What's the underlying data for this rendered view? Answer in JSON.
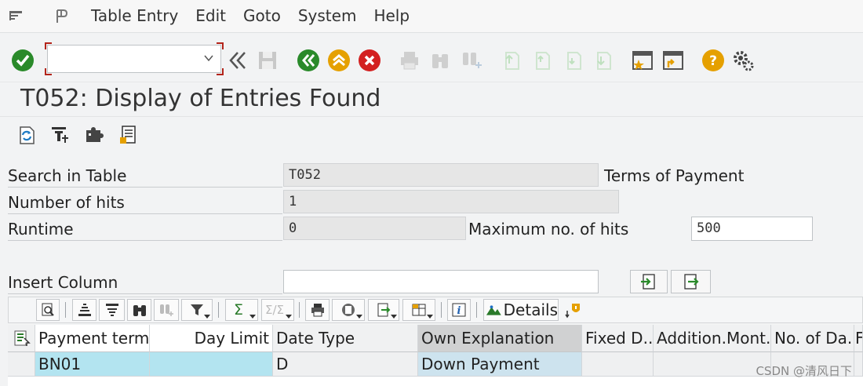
{
  "menu": [
    "Table Entry",
    "Edit",
    "Goto",
    "System",
    "Help"
  ],
  "command_field": {
    "value": ""
  },
  "title": "T052: Display of Entries Found",
  "search": {
    "search_label": "Search in Table",
    "search_value": "T052",
    "search_desc": "Terms of Payment",
    "hits_label": "Number of hits",
    "hits_value": "1",
    "runtime_label": "Runtime",
    "runtime_value": "0",
    "max_label": "Maximum no. of hits",
    "max_value": "500",
    "insert_label": "Insert Column",
    "insert_value": ""
  },
  "grid_toolbar": {
    "details_label": "Details"
  },
  "table": {
    "columns": [
      "Payment terms",
      "Day Limit",
      "Date Type",
      "Own Explanation",
      "Fixed D...",
      "Addition.Mont...",
      "No. of Da...",
      "F"
    ],
    "rows": [
      [
        "BN01",
        "",
        "D",
        "Down Payment",
        "",
        "",
        "",
        ""
      ]
    ]
  },
  "watermark": "CSDN @清风日下",
  "colors": {
    "accent_green": "#2a8a2a",
    "accent_orange": "#e5a000",
    "accent_red": "#d32020",
    "key_cell": "#b3e4f0"
  }
}
